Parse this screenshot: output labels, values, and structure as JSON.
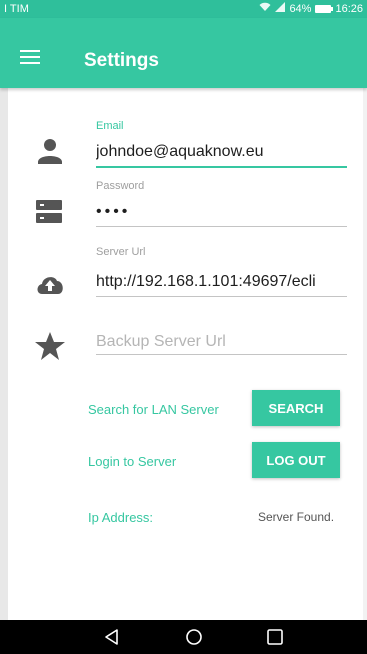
{
  "status_bar": {
    "carrier": "I TIM",
    "battery": "64%",
    "time": "16:26"
  },
  "app_bar": {
    "title": "Settings",
    "menu_icon": "hamburger-menu-icon"
  },
  "form": {
    "email": {
      "label": "Email",
      "value": "johndoe@aquaknow.eu",
      "icon": "person-icon"
    },
    "password": {
      "label": "Password",
      "value": "••••",
      "icon": "server-icon"
    },
    "server_url": {
      "label": "Server Url",
      "value": "http://192.168.1.101:49697/ecli",
      "icon": "cloud-upload-icon"
    },
    "backup_server_url": {
      "placeholder": "Backup Server Url",
      "icon": "star-icon"
    }
  },
  "actions": {
    "search_label": "Search for LAN Server",
    "search_button": "SEARCH",
    "login_label": "Login to Server",
    "logout_button": "LOG OUT"
  },
  "info": {
    "ip_label": "Ip Address:",
    "ip_value": "Server Found."
  },
  "colors": {
    "accent": "#36c7a1",
    "status_bar": "#2fbf9b",
    "nav_bar": "#000000"
  },
  "nav_bar": {
    "back_icon": "back-triangle-icon",
    "home_icon": "home-circle-icon",
    "recents_icon": "recents-square-icon"
  }
}
